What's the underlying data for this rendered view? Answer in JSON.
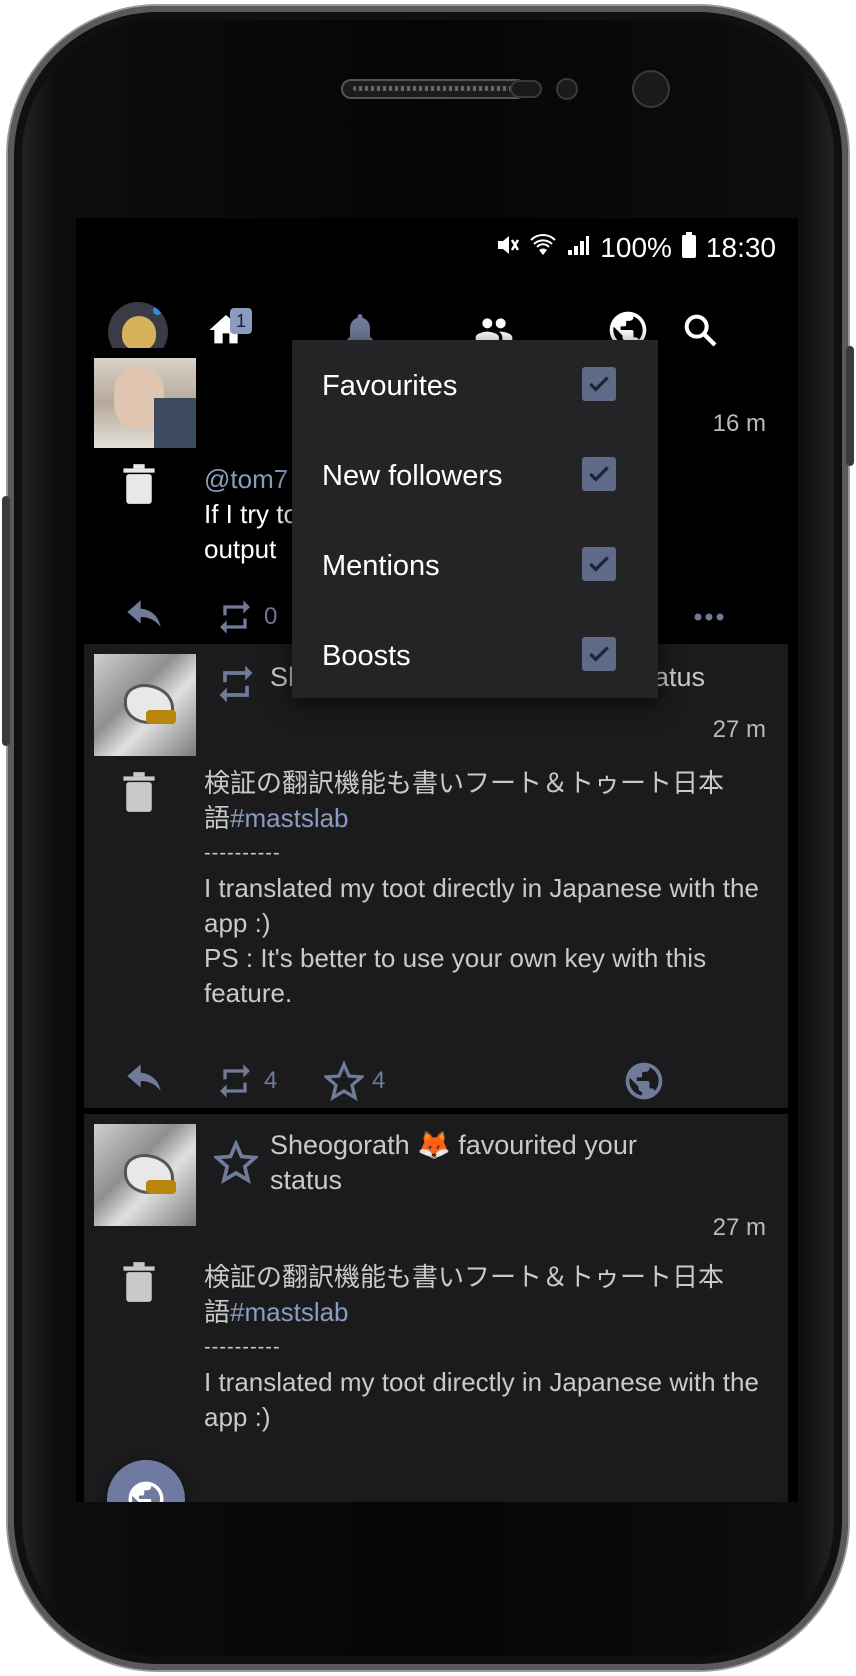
{
  "status_bar": {
    "battery": "100%",
    "time": "18:30",
    "icons": [
      "mute-icon",
      "wifi-icon",
      "signal-icon",
      "battery-icon"
    ]
  },
  "top_bar": {
    "home_badge": "1",
    "tabs": [
      "home-icon",
      "bell-icon",
      "people-icon",
      "globe-icon",
      "search-icon"
    ]
  },
  "menu": {
    "items": [
      {
        "label": "Favourites",
        "checked": true
      },
      {
        "label": "New followers",
        "checked": true
      },
      {
        "label": "Mentions",
        "checked": true
      },
      {
        "label": "Boosts",
        "checked": true
      }
    ]
  },
  "feed": {
    "items": [
      {
        "time": "16 m",
        "mention": "@tom7",
        "body_line1": "If I try to",
        "body_line2": "output",
        "boosts": "0"
      },
      {
        "actor_partial": "Sh",
        "notif_partial": "atus",
        "time": "27 m",
        "jp_line1": "検証の翻訳機能も書いフート＆トゥート日本",
        "jp_prefix": "語",
        "hashtag": "#mastslab",
        "dashes": "----------",
        "en_text": "I translated my toot directly in Japanese with the app :)",
        "ps_text": "PS : It's better to use your own key with this feature.",
        "boosts": "4",
        "favourites": "4"
      },
      {
        "notif_text": "Sheogorath 🦊 favourited your status",
        "time": "27 m",
        "jp_line1": "検証の翻訳機能も書いフート＆トゥート日本",
        "jp_prefix": "語",
        "hashtag": "#mastslab",
        "dashes": "----------",
        "en_text": "I translated my toot directly in Japanese with the app :)"
      }
    ]
  },
  "colors": {
    "accent": "#8a9bc0",
    "card_bg": "#1b1b1d",
    "menu_bg": "#242426",
    "checkbox": "#5f6a88",
    "icon_muted": "#6f7b97"
  }
}
